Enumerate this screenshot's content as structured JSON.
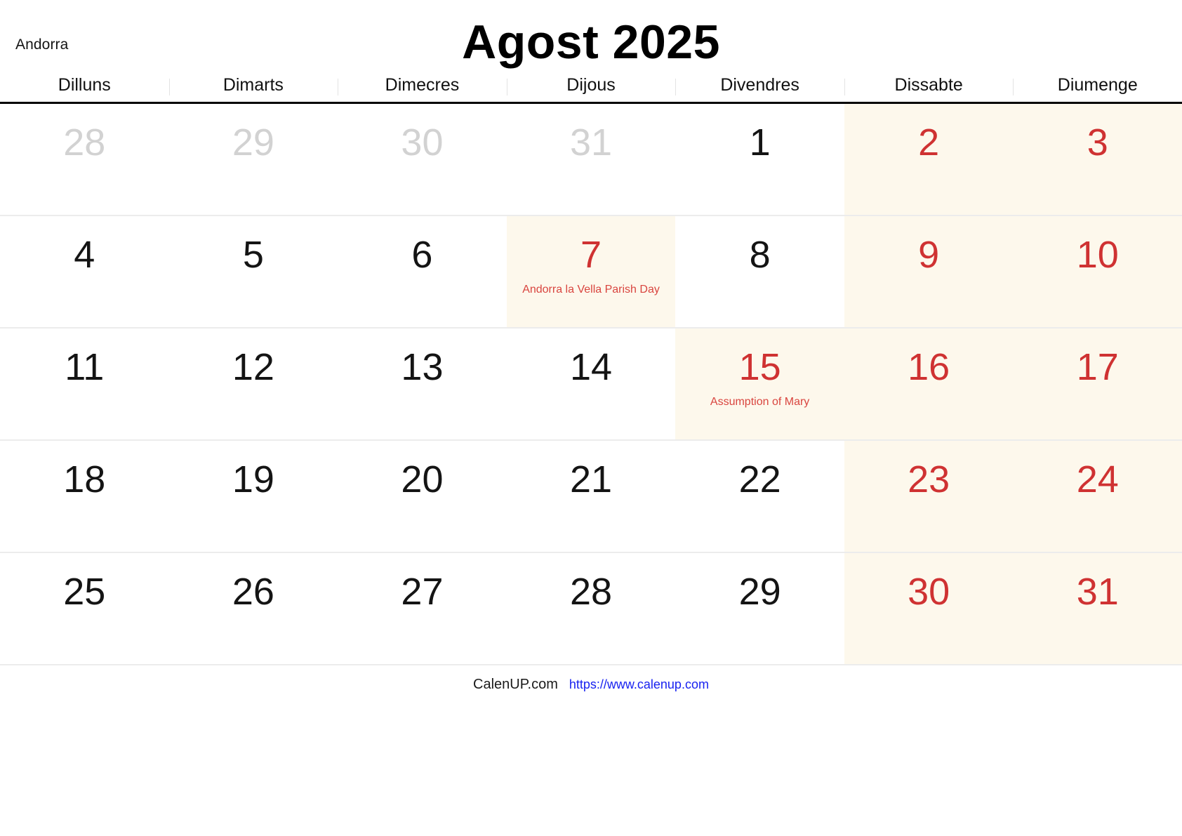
{
  "header": {
    "country": "Andorra",
    "title": "Agost 2025"
  },
  "weekdays": [
    {
      "label": "Dilluns"
    },
    {
      "label": "Dimarts"
    },
    {
      "label": "Dimecres"
    },
    {
      "label": "Dijous"
    },
    {
      "label": "Divendres"
    },
    {
      "label": "Dissabte"
    },
    {
      "label": "Diumenge"
    }
  ],
  "colors": {
    "weekend_background": "#fdf8ec",
    "holiday_background": "#fdf8ec",
    "red_day": "#cf3232",
    "event_text": "#d9453f",
    "other_month_day": "#d2d2d2",
    "header_rule": "#000000",
    "row_rule": "#ececec",
    "footer_link": "#1822f0"
  },
  "weeks": [
    [
      {
        "num": "28",
        "other_month": true,
        "red": false,
        "weekend": false,
        "holiday": false,
        "event": ""
      },
      {
        "num": "29",
        "other_month": true,
        "red": false,
        "weekend": false,
        "holiday": false,
        "event": ""
      },
      {
        "num": "30",
        "other_month": true,
        "red": false,
        "weekend": false,
        "holiday": false,
        "event": ""
      },
      {
        "num": "31",
        "other_month": true,
        "red": false,
        "weekend": false,
        "holiday": false,
        "event": ""
      },
      {
        "num": "1",
        "other_month": false,
        "red": false,
        "weekend": false,
        "holiday": false,
        "event": ""
      },
      {
        "num": "2",
        "other_month": false,
        "red": true,
        "weekend": true,
        "holiday": false,
        "event": ""
      },
      {
        "num": "3",
        "other_month": false,
        "red": true,
        "weekend": true,
        "holiday": false,
        "event": ""
      }
    ],
    [
      {
        "num": "4",
        "other_month": false,
        "red": false,
        "weekend": false,
        "holiday": false,
        "event": ""
      },
      {
        "num": "5",
        "other_month": false,
        "red": false,
        "weekend": false,
        "holiday": false,
        "event": ""
      },
      {
        "num": "6",
        "other_month": false,
        "red": false,
        "weekend": false,
        "holiday": false,
        "event": ""
      },
      {
        "num": "7",
        "other_month": false,
        "red": true,
        "weekend": false,
        "holiday": true,
        "event": "Andorra la Vella Parish Day"
      },
      {
        "num": "8",
        "other_month": false,
        "red": false,
        "weekend": false,
        "holiday": false,
        "event": ""
      },
      {
        "num": "9",
        "other_month": false,
        "red": true,
        "weekend": true,
        "holiday": false,
        "event": ""
      },
      {
        "num": "10",
        "other_month": false,
        "red": true,
        "weekend": true,
        "holiday": false,
        "event": ""
      }
    ],
    [
      {
        "num": "11",
        "other_month": false,
        "red": false,
        "weekend": false,
        "holiday": false,
        "event": ""
      },
      {
        "num": "12",
        "other_month": false,
        "red": false,
        "weekend": false,
        "holiday": false,
        "event": ""
      },
      {
        "num": "13",
        "other_month": false,
        "red": false,
        "weekend": false,
        "holiday": false,
        "event": ""
      },
      {
        "num": "14",
        "other_month": false,
        "red": false,
        "weekend": false,
        "holiday": false,
        "event": ""
      },
      {
        "num": "15",
        "other_month": false,
        "red": true,
        "weekend": false,
        "holiday": true,
        "event": "Assumption of Mary"
      },
      {
        "num": "16",
        "other_month": false,
        "red": true,
        "weekend": true,
        "holiday": false,
        "event": ""
      },
      {
        "num": "17",
        "other_month": false,
        "red": true,
        "weekend": true,
        "holiday": false,
        "event": ""
      }
    ],
    [
      {
        "num": "18",
        "other_month": false,
        "red": false,
        "weekend": false,
        "holiday": false,
        "event": ""
      },
      {
        "num": "19",
        "other_month": false,
        "red": false,
        "weekend": false,
        "holiday": false,
        "event": ""
      },
      {
        "num": "20",
        "other_month": false,
        "red": false,
        "weekend": false,
        "holiday": false,
        "event": ""
      },
      {
        "num": "21",
        "other_month": false,
        "red": false,
        "weekend": false,
        "holiday": false,
        "event": ""
      },
      {
        "num": "22",
        "other_month": false,
        "red": false,
        "weekend": false,
        "holiday": false,
        "event": ""
      },
      {
        "num": "23",
        "other_month": false,
        "red": true,
        "weekend": true,
        "holiday": false,
        "event": ""
      },
      {
        "num": "24",
        "other_month": false,
        "red": true,
        "weekend": true,
        "holiday": false,
        "event": ""
      }
    ],
    [
      {
        "num": "25",
        "other_month": false,
        "red": false,
        "weekend": false,
        "holiday": false,
        "event": ""
      },
      {
        "num": "26",
        "other_month": false,
        "red": false,
        "weekend": false,
        "holiday": false,
        "event": ""
      },
      {
        "num": "27",
        "other_month": false,
        "red": false,
        "weekend": false,
        "holiday": false,
        "event": ""
      },
      {
        "num": "28",
        "other_month": false,
        "red": false,
        "weekend": false,
        "holiday": false,
        "event": ""
      },
      {
        "num": "29",
        "other_month": false,
        "red": false,
        "weekend": false,
        "holiday": false,
        "event": ""
      },
      {
        "num": "30",
        "other_month": false,
        "red": true,
        "weekend": true,
        "holiday": false,
        "event": ""
      },
      {
        "num": "31",
        "other_month": false,
        "red": true,
        "weekend": true,
        "holiday": false,
        "event": ""
      }
    ]
  ],
  "footer": {
    "brand": "CalenUP.com",
    "url": "https://www.calenup.com"
  }
}
